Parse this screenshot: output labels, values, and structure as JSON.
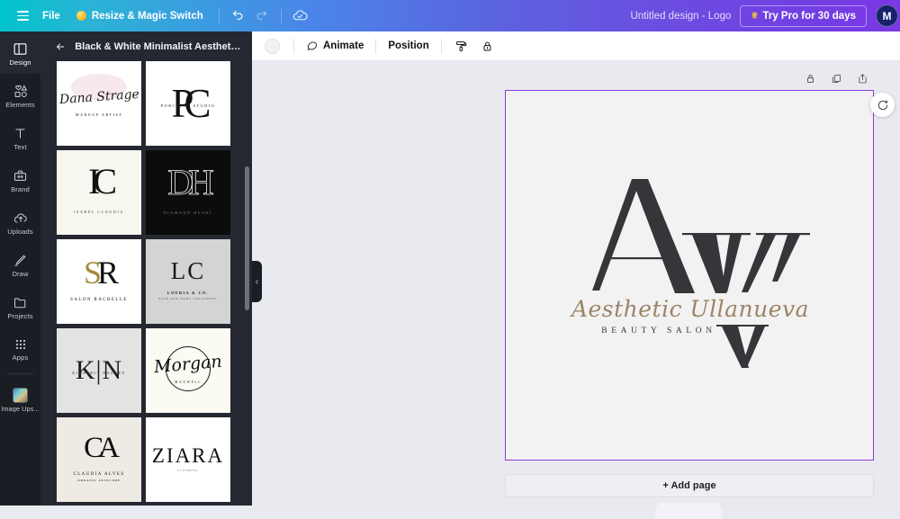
{
  "topbar": {
    "menu_icon": "hamburger-icon",
    "file_label": "File",
    "resize_label": "Resize & Magic Switch",
    "undo_icon": "undo-icon",
    "redo_icon": "redo-icon",
    "cloud_status_icon": "cloud-saved-icon",
    "doc_title": "Untitled design - Logo",
    "try_pro_label": "Try Pro for 30 days",
    "avatar_initial": "M",
    "gradient_start": "#00c4cc",
    "gradient_end": "#7a37e6"
  },
  "rail": {
    "items": [
      {
        "label": "Design",
        "icon": "design-icon",
        "active": true
      },
      {
        "label": "Elements",
        "icon": "elements-icon",
        "active": false
      },
      {
        "label": "Text",
        "icon": "text-icon",
        "active": false
      },
      {
        "label": "Brand",
        "icon": "brand-icon",
        "active": false
      },
      {
        "label": "Uploads",
        "icon": "uploads-icon",
        "active": false
      },
      {
        "label": "Draw",
        "icon": "draw-icon",
        "active": false
      },
      {
        "label": "Projects",
        "icon": "projects-icon",
        "active": false
      },
      {
        "label": "Apps",
        "icon": "apps-icon",
        "active": false
      }
    ],
    "app_item": {
      "label": "Image Ups...",
      "icon": "image-upscaler-thumbnail"
    }
  },
  "panel": {
    "back_icon": "back-arrow-icon",
    "title": "Black & White Minimalist Aesthetic Initi...",
    "templates": [
      {
        "id": "t1",
        "bg": "#ffffff",
        "monogram": "",
        "script": "Dana Strage",
        "caption": "MAKEUP ARTIST",
        "style": "script"
      },
      {
        "id": "t2",
        "bg": "#ffffff",
        "monogram": "PC",
        "script": "",
        "caption": "PORCELLE STUDIO",
        "style": "mono-overlap"
      },
      {
        "id": "t3",
        "bg": "#f7f6ef",
        "monogram": "IC",
        "script": "",
        "caption": "ISABEL CLAUDIA",
        "style": "mono-floral"
      },
      {
        "id": "t4",
        "bg": "#0c0c0c",
        "monogram": "DH",
        "script": "",
        "caption": "DIAMOND HEART",
        "style": "mono-outline-dark"
      },
      {
        "id": "t5",
        "bg": "#ffffff",
        "monogram": "SR",
        "script": "",
        "caption": "SALON RACHELLE",
        "style": "mono-gold"
      },
      {
        "id": "t6",
        "bg": "#d4d4d4",
        "monogram": "LC",
        "script": "",
        "caption": "LOERIA & CO.",
        "caption2": "HAIR AND BODY TREATMENT",
        "style": "mono-thin"
      },
      {
        "id": "t7",
        "bg": "#e3e3e3",
        "monogram": "K|N",
        "script": "",
        "caption": "KIMBERLY NGUYEN",
        "style": "mono-split"
      },
      {
        "id": "t8",
        "bg": "#fbfbf4",
        "monogram": "",
        "script": "Morgan",
        "caption": "MAXWELL",
        "style": "script-circle"
      },
      {
        "id": "t9",
        "bg": "#eeeae4",
        "monogram": "CA",
        "script": "",
        "caption": "CLAUDIA ALVES",
        "caption2": "ORGANIC SKINCARE",
        "style": "mono-serif"
      },
      {
        "id": "t10",
        "bg": "#ffffff",
        "monogram": "",
        "script": "",
        "caption": "ZIARA",
        "caption2": "CLOTHING",
        "style": "wordmark"
      },
      {
        "id": "t11",
        "bg": "#e6ddd4",
        "monogram": "",
        "script": "",
        "caption": "",
        "style": "partial"
      },
      {
        "id": "t12",
        "bg": "#ffffff",
        "monogram": "",
        "script": "",
        "caption": "",
        "style": "partial"
      }
    ]
  },
  "editor_toolbar": {
    "color_swatch_label": "",
    "animate_label": "Animate",
    "animate_icon": "animate-icon",
    "position_label": "Position",
    "transparency_icon": "paint-roller-icon",
    "lock_icon": "lock-icon"
  },
  "page_tools": {
    "lock_icon": "lock-icon",
    "duplicate_icon": "duplicate-page-icon",
    "export_icon": "share-export-icon",
    "magic_icon": "magic-refresh-icon"
  },
  "canvas": {
    "border_color": "#8b3dd6",
    "background": "#f2f2f2",
    "logo": {
      "letter_a": "A",
      "letter_v_upper": "V",
      "letter_v_lower": "V",
      "script_text": "Aesthetic Ullanueva",
      "subtitle": "BEAUTY SALON",
      "script_color": "#9c8468",
      "letter_color": "#35353a"
    },
    "add_page_label": "+ Add page"
  }
}
